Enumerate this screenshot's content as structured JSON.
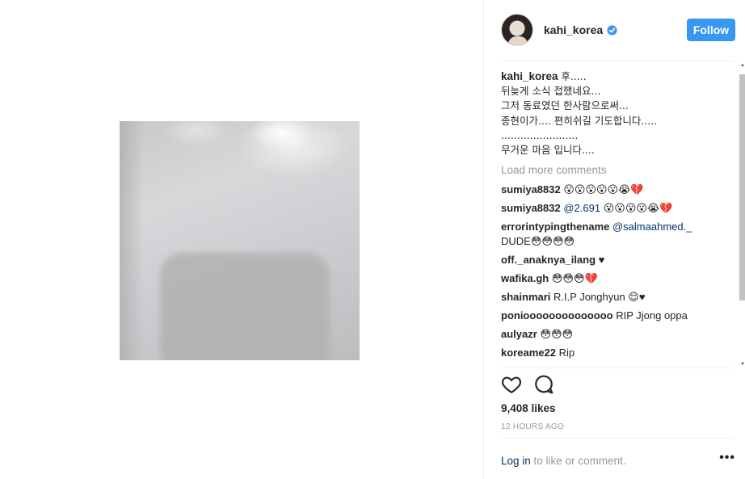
{
  "post": {
    "username": "kahi_korea",
    "verified": true,
    "follow_label": "Follow",
    "caption_lines": [
      "후.....",
      "뒤늦게 소식 접했네요...",
      "그저 동료였던 한사람으로써...",
      "종현이가.... 편히쉬길 기도합니다.....",
      "........................",
      "무거운 마음 입니다...."
    ],
    "load_more": "Load more comments",
    "comments": [
      {
        "user": "sumiya8832",
        "mention": "",
        "text": "😮😮😮😮😮😭💔"
      },
      {
        "user": "sumiya8832",
        "mention": "@2.691",
        "text": "😮😮😮😮😭💔"
      },
      {
        "user": "errorintypingthename",
        "mention": "@salmaahmed._",
        "text": "DUDE😳😳😳😳"
      },
      {
        "user": "off._anaknya_ilang",
        "mention": "",
        "text": "♥"
      },
      {
        "user": "wafika.gh",
        "mention": "",
        "text": "😳😳😳💔"
      },
      {
        "user": "shainmari",
        "mention": "",
        "text": "R.I.P Jonghyun 😌♥"
      },
      {
        "user": "ponioooooooooooooo",
        "mention": "",
        "text": "RIP Jjong oppa"
      },
      {
        "user": "aulyazr",
        "mention": "",
        "text": "😳😳😳"
      },
      {
        "user": "koreame22",
        "mention": "",
        "text": "Rip"
      }
    ],
    "likes": "9,408 likes",
    "time": "12 HOURS AGO",
    "login_link": "Log in",
    "login_suffix": " to like or comment.",
    "more_options": "•••"
  },
  "colors": {
    "follow_button": "#3897f0",
    "verified_badge": "#3897f0",
    "link": "#003569",
    "muted": "#999999"
  },
  "icons": [
    "verified-badge-icon",
    "heart-icon",
    "comment-icon",
    "more-options-icon"
  ]
}
